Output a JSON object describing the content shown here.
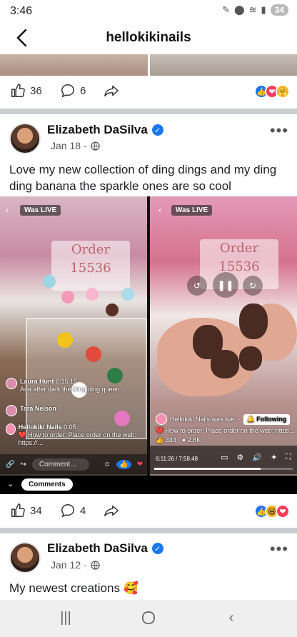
{
  "status_bar": {
    "time": "3:46",
    "battery": "34"
  },
  "header": {
    "title": "hellokikinails"
  },
  "prev_post": {
    "likes": "36",
    "comments": "6"
  },
  "post1": {
    "author": "Elizabeth DaSilva",
    "date": "Jan 18 ·",
    "text": "Love my new collection of ding dings and my ding ding banana the sparkle ones are so cool",
    "video_left": {
      "badge": "Was LIVE",
      "order_text": "Order 15536",
      "comments": [
        {
          "name": "Laura Hunt",
          "time": "6:15:15",
          "text": "Aria after dark the Ding ding queen"
        },
        {
          "name": "Tara Nelson",
          "time": "",
          "text": ""
        },
        {
          "name": "Hellokiki Nails",
          "time": "0:05",
          "text": "❤️ How to order: Place order on the web: https://..."
        }
      ],
      "comment_placeholder": "Comment..."
    },
    "video_right": {
      "badge": "Was LIVE",
      "order_text": "Order 15536",
      "live_text": "Hellokiki Nails was live. ·",
      "follow_label": "Following",
      "order_info": "❤️ How to order: Place order on the web: https...",
      "views": "333",
      "reactions": "2.8K",
      "time_current": "6:11:26",
      "time_total": "7:58:48",
      "progress": 0.77
    },
    "comments_label": "Comments",
    "likes": "34",
    "comments": "4"
  },
  "post2": {
    "author": "Elizabeth DaSilva",
    "date": "Jan 12 ·",
    "text": "My newest creations 🥰"
  },
  "icons": {
    "like": "thumb-up-icon",
    "comment": "comment-bubble-icon",
    "share": "share-arrow-icon"
  }
}
